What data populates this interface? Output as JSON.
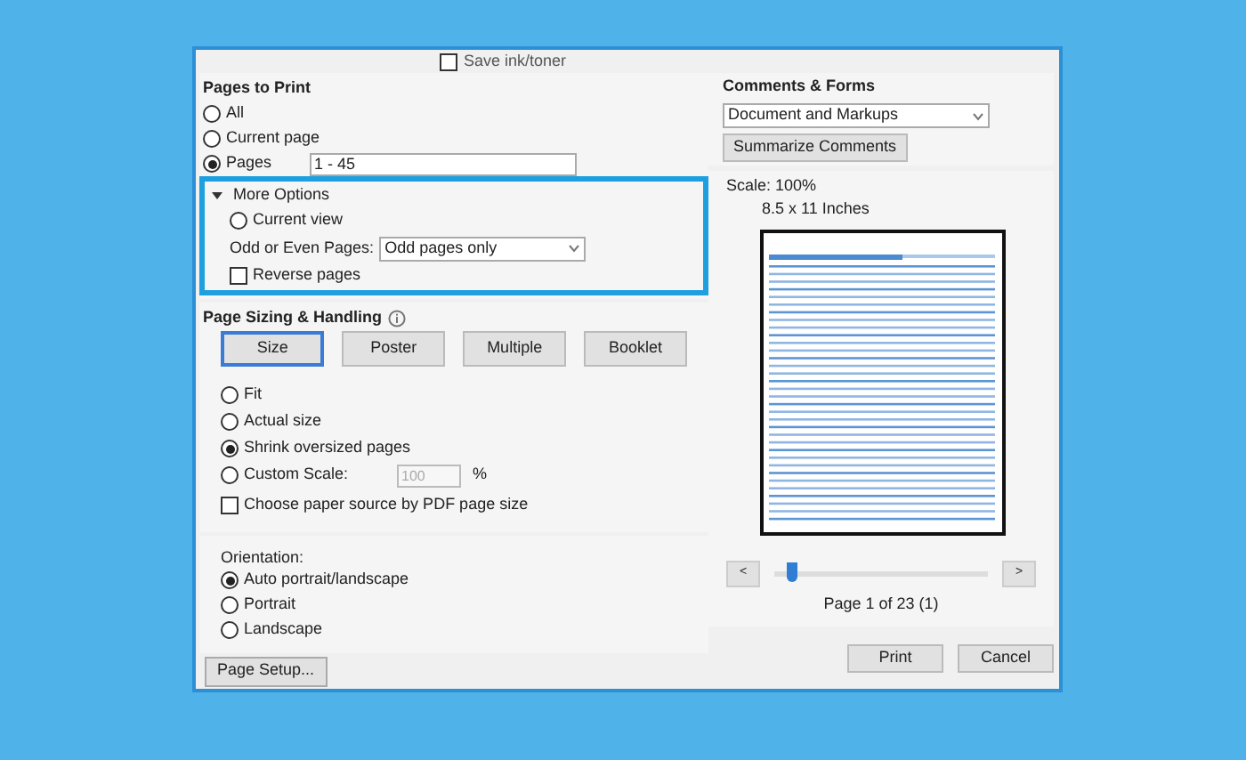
{
  "top_option": {
    "label": "Save ink/toner",
    "checked": false
  },
  "pages_to_print": {
    "title": "Pages to Print",
    "options": [
      {
        "label": "All",
        "selected": false
      },
      {
        "label": "Current page",
        "selected": false
      },
      {
        "label": "Pages",
        "selected": true,
        "value": "1 - 45"
      }
    ],
    "more_options": {
      "label": "More Options",
      "expanded": true,
      "current_view": {
        "label": "Current view",
        "selected": false
      },
      "odd_even": {
        "label": "Odd or Even Pages:",
        "value": "Odd pages only"
      },
      "reverse": {
        "label": "Reverse pages",
        "checked": false
      }
    }
  },
  "page_sizing": {
    "title": "Page Sizing & Handling",
    "buttons": [
      {
        "label": "Size",
        "selected": true
      },
      {
        "label": "Poster",
        "selected": false
      },
      {
        "label": "Multiple",
        "selected": false
      },
      {
        "label": "Booklet",
        "selected": false
      }
    ],
    "options": [
      {
        "label": "Fit",
        "selected": false
      },
      {
        "label": "Actual size",
        "selected": false
      },
      {
        "label": "Shrink oversized pages",
        "selected": true
      },
      {
        "label": "Custom Scale:",
        "selected": false,
        "value": "100",
        "disabled": true,
        "unit": "%"
      }
    ],
    "paper_source": {
      "label": "Choose paper source by PDF page size",
      "checked": false
    }
  },
  "orientation": {
    "title": "Orientation:",
    "options": [
      {
        "label": "Auto portrait/landscape",
        "selected": true
      },
      {
        "label": "Portrait",
        "selected": false
      },
      {
        "label": "Landscape",
        "selected": false
      }
    ]
  },
  "page_setup_button": "Page Setup...",
  "comments_forms": {
    "title": "Comments & Forms",
    "value": "Document and Markups",
    "button": "Summarize Comments"
  },
  "preview": {
    "scale": "Scale: 100%",
    "paper": "8.5 x 11 Inches",
    "prev": "<",
    "next": ">",
    "level": 0.06,
    "page": "Page 1 of 23 (1)"
  },
  "buttons": [
    "Print",
    "Cancel"
  ]
}
